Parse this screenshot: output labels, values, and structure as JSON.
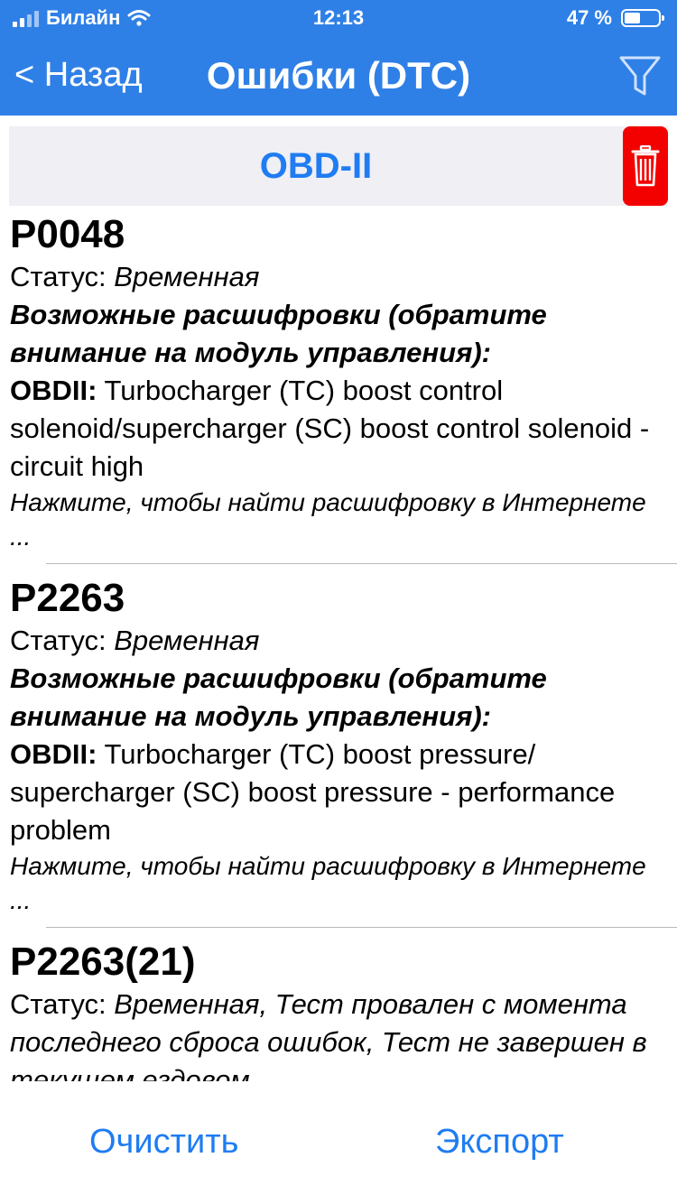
{
  "status_bar": {
    "carrier": "Билайн",
    "time": "12:13",
    "battery": "47 %",
    "battery_level": 0.47
  },
  "nav": {
    "back_label": "< Назад",
    "title": "Ошибки (DTC)",
    "filter_icon": "filter-icon"
  },
  "section": {
    "title": "OBD-II",
    "delete_icon": "trash-icon"
  },
  "items": [
    {
      "code": "P0048",
      "status_label": "Статус: ",
      "status_value": "Временная",
      "decode_header": "Возможные расшифровки (обратите внимание на модуль управления):",
      "source": "OBDII:",
      "description": " Turbocharger (TC) boost control solenoid/supercharger (SC) boost control solenoid - circuit high",
      "hint": "Нажмите, чтобы найти расшифровку в Интернете ..."
    },
    {
      "code": "P2263",
      "status_label": "Статус: ",
      "status_value": "Временная",
      "decode_header": "Возможные расшифровки (обратите внимание на модуль управления):",
      "source": "OBDII:",
      "description": " Turbocharger (TC) boost pressure/ supercharger (SC) boost pressure - performance problem",
      "hint": "Нажмите, чтобы найти расшифровку в Интернете ..."
    },
    {
      "code": "P2263(21)",
      "status_label": "Статус: ",
      "status_value": "Временная, Тест провален с момента последнего сброса ошибок, Тест не завершен в текущем ездовом"
    }
  ],
  "toolbar": {
    "clear_label": "Очистить",
    "export_label": "Экспорт"
  },
  "colors": {
    "nav_bar": "#2f80e6",
    "accent": "#1f7cf2",
    "delete": "#f30000",
    "section_bg": "#efeff4"
  }
}
